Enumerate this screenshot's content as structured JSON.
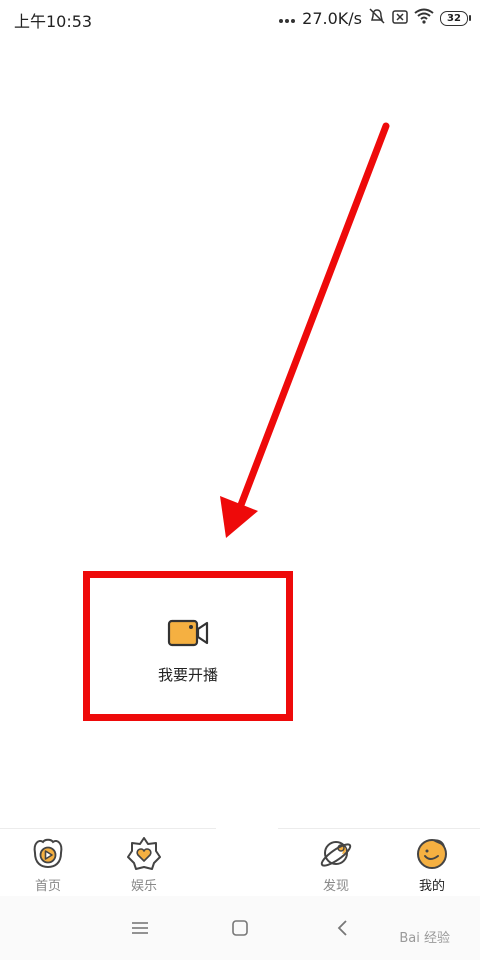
{
  "status_bar": {
    "time": "上午10:53",
    "net_speed": "27.0K/s",
    "battery_level": "32",
    "icons": [
      "signal-dots-icon",
      "mute-bell-icon",
      "sim-icon",
      "wifi-icon",
      "battery-icon"
    ]
  },
  "main": {
    "start_live_label": "我要开播",
    "camera_icon": "video-camera-icon",
    "annotation_color": "#ee0a0a",
    "accent": "#f5b041"
  },
  "tabs": [
    {
      "label": "首页",
      "icon": "home-play-icon",
      "active": false
    },
    {
      "label": "娱乐",
      "icon": "entertainment-heart-icon",
      "active": false
    },
    {
      "label": "发现",
      "icon": "planet-icon",
      "active": false
    },
    {
      "label": "我的",
      "icon": "profile-face-icon",
      "active": true
    }
  ],
  "system_nav": {
    "buttons": [
      "menu-icon",
      "home-square-icon",
      "back-icon"
    ]
  },
  "watermark": "Bai 经验"
}
